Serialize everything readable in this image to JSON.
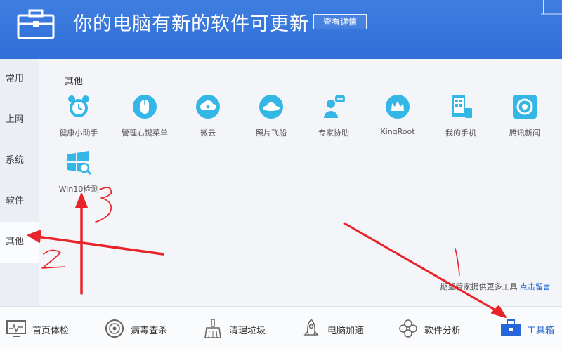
{
  "header": {
    "title": "你的电脑有新的软件可更新",
    "details_button": "查看详情",
    "icon": "toolbox-icon"
  },
  "sidebar": {
    "items": [
      {
        "label": "常用"
      },
      {
        "label": "上网"
      },
      {
        "label": "系统"
      },
      {
        "label": "软件"
      },
      {
        "label": "其他",
        "active": true
      }
    ]
  },
  "content": {
    "section_title": "其他",
    "tools": [
      {
        "label": "健康小助手",
        "icon": "alarm-clock-icon"
      },
      {
        "label": "管理右键菜单",
        "icon": "mouse-icon"
      },
      {
        "label": "微云",
        "icon": "cloud-icon"
      },
      {
        "label": "照片飞船",
        "icon": "ufo-icon"
      },
      {
        "label": "专家协助",
        "icon": "expert-chat-icon"
      },
      {
        "label": "KingRoot",
        "icon": "crown-icon"
      },
      {
        "label": "我的手机",
        "icon": "phone-icon"
      },
      {
        "label": "腾讯新闻",
        "icon": "news-icon"
      },
      {
        "label": "Win10检测",
        "icon": "windows-search-icon"
      }
    ],
    "hint_text": "期望管家提供更多工具",
    "hint_link": "点击留言"
  },
  "bottom_bar": {
    "items": [
      {
        "label": "首页体检",
        "icon": "monitor-icon"
      },
      {
        "label": "病毒查杀",
        "icon": "target-icon"
      },
      {
        "label": "清理垃圾",
        "icon": "broom-icon"
      },
      {
        "label": "电脑加速",
        "icon": "rocket-icon"
      },
      {
        "label": "软件分析",
        "icon": "puzzle-icon"
      },
      {
        "label": "工具箱",
        "icon": "toolbox-icon",
        "active": true
      }
    ]
  },
  "annotations": {
    "marks": [
      "2",
      "3",
      "1"
    ],
    "color": "#e8232a"
  },
  "colors": {
    "header": "#2f6fd8",
    "icon_accent": "#34b6e6",
    "link": "#1d63d4"
  }
}
